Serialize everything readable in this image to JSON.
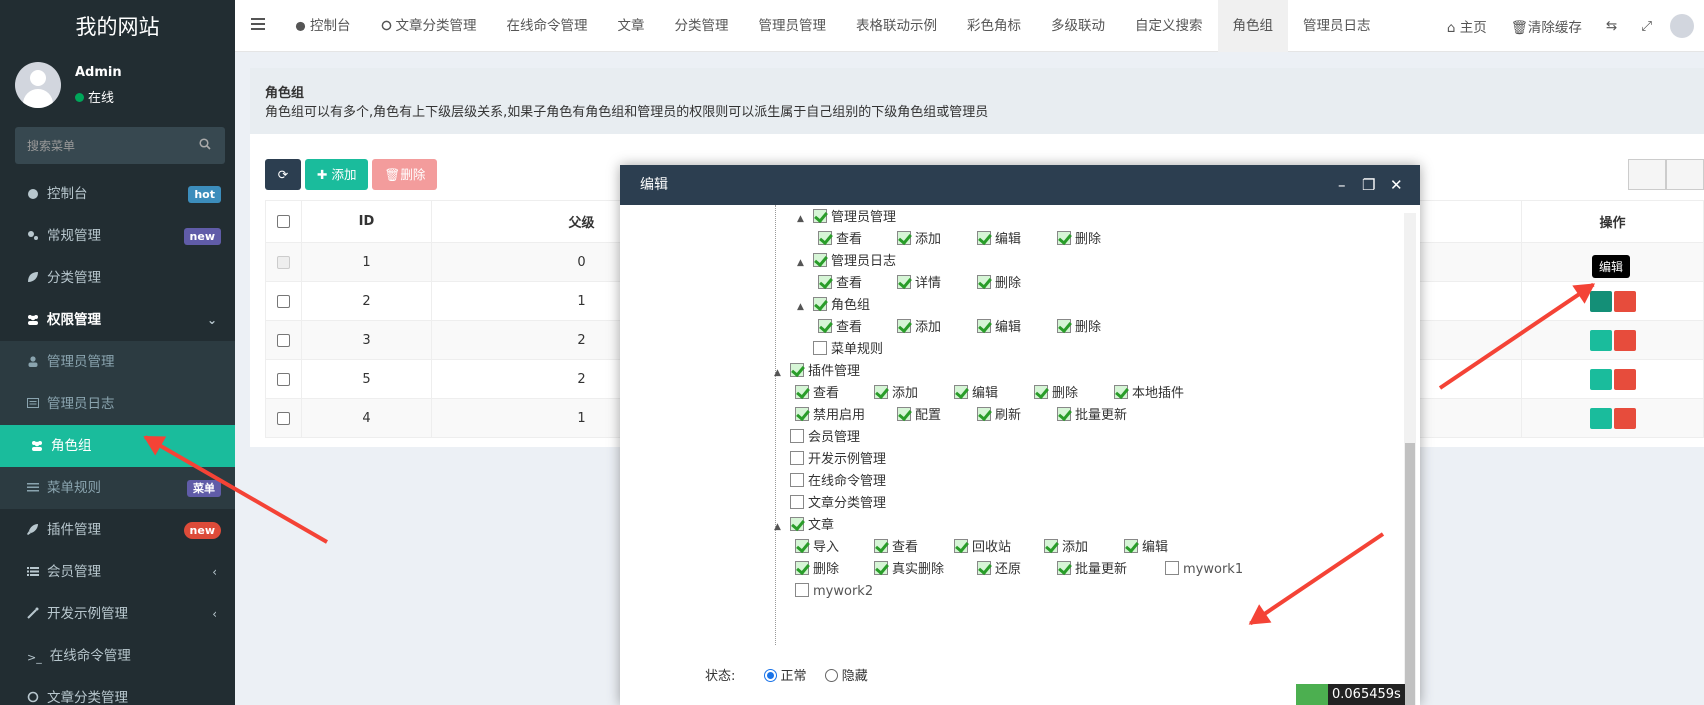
{
  "site_title": "我的网站",
  "user": {
    "name": "Admin",
    "status": "在线"
  },
  "search": {
    "placeholder": "搜索菜单"
  },
  "menu": [
    {
      "label": "控制台",
      "badge": "hot"
    },
    {
      "label": "常规管理",
      "badge": "new"
    },
    {
      "label": "分类管理"
    },
    {
      "label": "权限管理"
    },
    {
      "label": "管理员管理"
    },
    {
      "label": "管理员日志"
    },
    {
      "label": "角色组"
    },
    {
      "label": "菜单规则",
      "badge": "菜单"
    },
    {
      "label": "插件管理",
      "badge": "new"
    },
    {
      "label": "会员管理"
    },
    {
      "label": "开发示例管理"
    },
    {
      "label": "在线命令管理"
    },
    {
      "label": "文章分类管理"
    }
  ],
  "tabs": [
    "控制台",
    "文章分类管理",
    "在线命令管理",
    "文章",
    "分类管理",
    "管理员管理",
    "表格联动示例",
    "彩色角标",
    "多级联动",
    "自定义搜索",
    "角色组",
    "管理员日志"
  ],
  "nav_right": {
    "home": "主页",
    "clear_cache": "清除缓存"
  },
  "page": {
    "title": "角色组",
    "desc": "角色组可以有多个,角色有上下级层级关系,如果子角色有角色组和管理员的权限则可以派生属于自己组别的下级角色组或管理员"
  },
  "toolbar": {
    "add": "添加",
    "delete": "删除"
  },
  "table": {
    "headers": [
      "ID",
      "父级",
      "操作"
    ],
    "rows": [
      {
        "id": "1",
        "parent": "0"
      },
      {
        "id": "2",
        "parent": "1"
      },
      {
        "id": "3",
        "parent": "2"
      },
      {
        "id": "5",
        "parent": "2"
      },
      {
        "id": "4",
        "parent": "1"
      }
    ]
  },
  "tooltip": "编辑",
  "modal": {
    "title": "编辑",
    "status_label": "状态:",
    "status_normal": "正常",
    "status_hidden": "隐藏",
    "tree": {
      "admin_manage": "管理员管理",
      "admin_manage_perms": [
        "查看",
        "添加",
        "编辑",
        "删除"
      ],
      "admin_log": "管理员日志",
      "admin_log_perms": [
        "查看",
        "详情",
        "删除"
      ],
      "role_group": "角色组",
      "role_group_perms": [
        "查看",
        "添加",
        "编辑",
        "删除"
      ],
      "menu_rule": "菜单规则",
      "plugin": "插件管理",
      "plugin_perms_1": [
        "查看",
        "添加",
        "编辑",
        "删除",
        "本地插件"
      ],
      "plugin_perms_2": [
        "禁用启用",
        "配置",
        "刷新",
        "批量更新"
      ],
      "member": "会员管理",
      "dev_example": "开发示例管理",
      "online_cmd": "在线命令管理",
      "article_cat": "文章分类管理",
      "article": "文章",
      "article_perms_1": [
        "导入",
        "查看",
        "回收站",
        "添加",
        "编辑"
      ],
      "article_perms_2": [
        "删除",
        "真实删除",
        "还原",
        "批量更新"
      ],
      "mywork1": "mywork1",
      "mywork2": "mywork2"
    }
  },
  "timer": "0.065459s"
}
